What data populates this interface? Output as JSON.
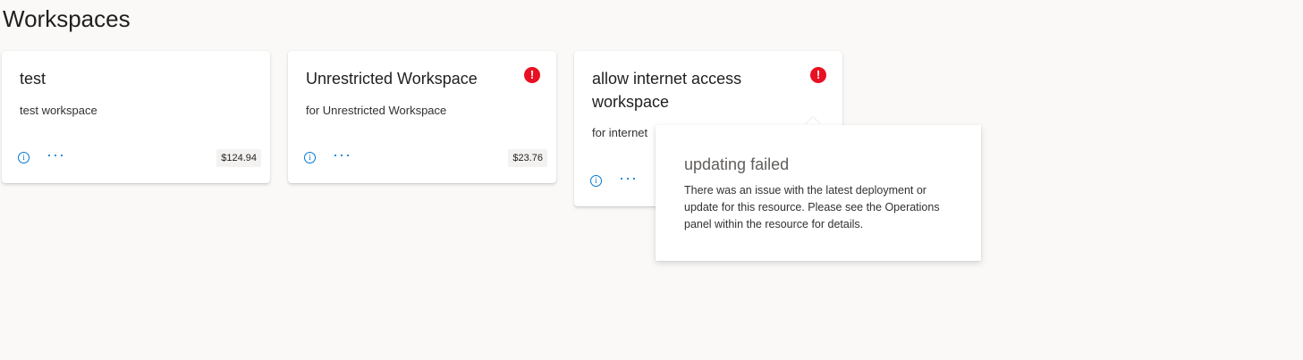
{
  "page": {
    "title": "Workspaces"
  },
  "workspaces": [
    {
      "title": "test",
      "description": "test workspace",
      "cost": "$124.94",
      "has_alert": false
    },
    {
      "title": "Unrestricted Workspace",
      "description": "for Unrestricted Workspace",
      "cost": "$23.76",
      "has_alert": true
    },
    {
      "title": "allow internet access workspace",
      "description": "for internet",
      "cost": "",
      "has_alert": true
    }
  ],
  "callout": {
    "title": "updating failed",
    "body": "There was an issue with the latest deployment or update for this resource. Please see the Operations panel within the resource for details."
  },
  "icons": {
    "alert": "error-badge-icon",
    "info": "info-icon",
    "more": "more-ellipsis-icon"
  },
  "colors": {
    "background": "#faf9f8",
    "accent": "#0078d4",
    "error": "#e81123"
  }
}
